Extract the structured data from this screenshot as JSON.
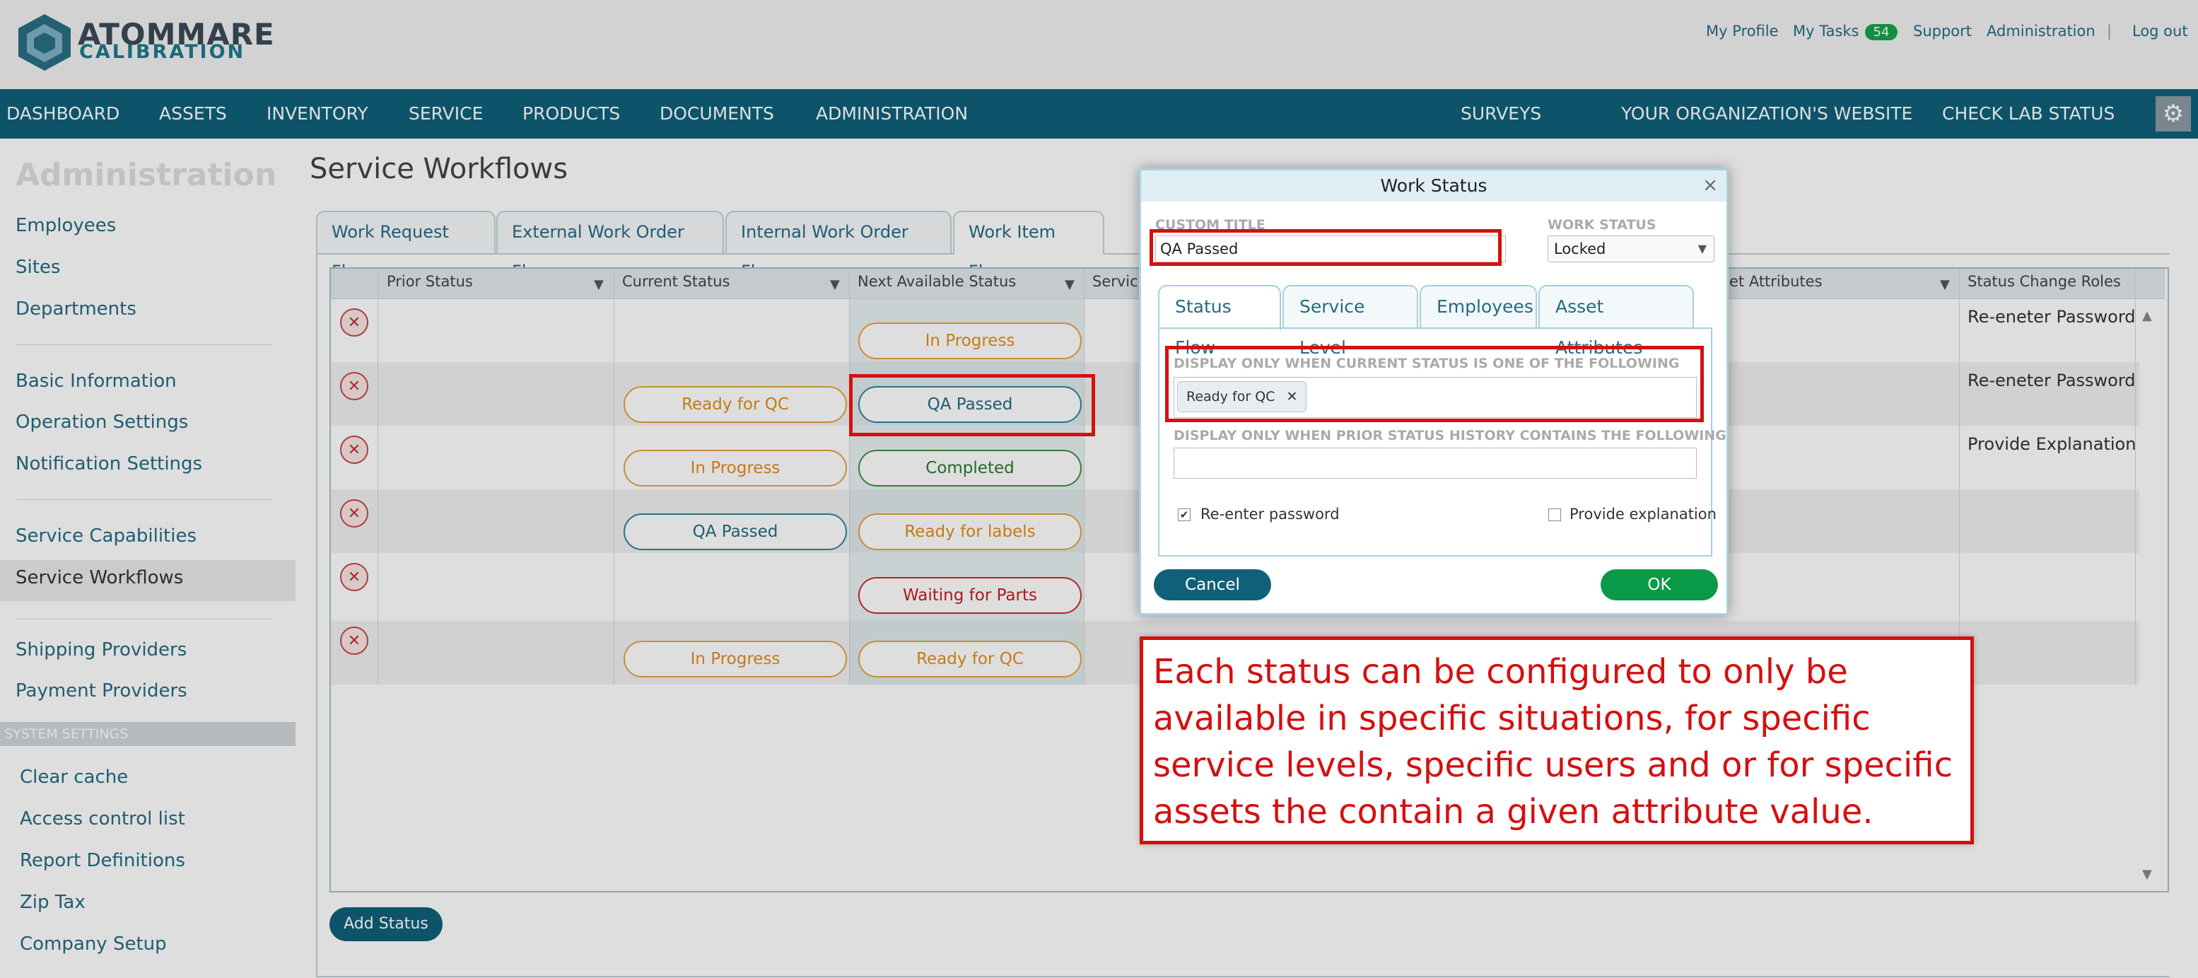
{
  "brand": {
    "line1": "ATOMMARE",
    "line2": "CALIBRATION"
  },
  "toplinks": {
    "profile": "My Profile",
    "tasks": "My Tasks",
    "tasks_count": "54",
    "support": "Support",
    "admin": "Administration",
    "sep": "|",
    "logout": "Log out"
  },
  "nav": {
    "dashboard": "DASHBOARD",
    "assets": "ASSETS",
    "inventory": "INVENTORY",
    "service": "SERVICE",
    "products": "PRODUCTS",
    "documents": "DOCUMENTS",
    "administration": "ADMINISTRATION",
    "surveys": "SURVEYS",
    "website": "YOUR ORGANIZATION'S WEBSITE",
    "lab": "CHECK LAB STATUS"
  },
  "sidebar": {
    "heading": "Administration",
    "employees": "Employees",
    "sites": "Sites",
    "departments": "Departments",
    "basic": "Basic Information",
    "operation": "Operation Settings",
    "notification": "Notification Settings",
    "capabilities": "Service Capabilities",
    "workflows": "Service Workflows",
    "shipping": "Shipping Providers",
    "payment": "Payment Providers",
    "system": "SYSTEM SETTINGS",
    "cache": "Clear cache",
    "acl": "Access control list",
    "reports": "Report Definitions",
    "zip": "Zip Tax",
    "company": "Company Setup"
  },
  "page": {
    "title": "Service Workflows"
  },
  "tabs": {
    "t1": "Work Request Flow",
    "t2": "External Work Order Flow",
    "t3": "Internal Work Order Flow",
    "t4": "Work Item Flow"
  },
  "grid": {
    "headers": {
      "prior": "Prior Status",
      "current": "Current Status",
      "next": "Next Available Status",
      "service": "Service",
      "attrs": "et Attributes",
      "roles": "Status Change Roles"
    },
    "rows": [
      {
        "current": "",
        "next": "In Progress",
        "role": "Re-eneter Password"
      },
      {
        "current": "Ready for QC",
        "next": "QA Passed",
        "role": "Re-eneter Password"
      },
      {
        "current": "In Progress",
        "next": "Completed",
        "role": "Provide Explanation"
      },
      {
        "current": "QA Passed",
        "next": "Ready for labels",
        "role": ""
      },
      {
        "current": "",
        "next": "Waiting for Parts",
        "role": ""
      },
      {
        "current": "In Progress",
        "next": "Ready for QC",
        "role": ""
      }
    ],
    "add_status": "Add Status"
  },
  "modal": {
    "title": "Work Status",
    "custom_title_label": "CUSTOM TITLE",
    "custom_title_value": "QA Passed",
    "work_status_label": "WORK STATUS",
    "work_status_value": "Locked",
    "tabs": {
      "flow": "Status Flow",
      "level": "Service Level",
      "employees": "Employees",
      "attrs": "Asset Attributes"
    },
    "current_label": "DISPLAY ONLY WHEN CURRENT STATUS IS ONE OF THE FOLLOWING",
    "chip": "Ready for QC",
    "prior_label": "DISPLAY ONLY WHEN PRIOR STATUS HISTORY CONTAINS THE FOLLOWING",
    "reenter": "Re-enter password",
    "explain": "Provide explanation",
    "cancel": "Cancel",
    "ok": "OK"
  },
  "callout": {
    "text": "Each status can be configured to only be available in specific situations, for specific service levels, specific users and or for specific assets the contain a given attribute value."
  }
}
